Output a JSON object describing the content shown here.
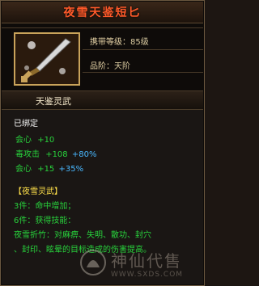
{
  "item": {
    "name": "夜雪天鉴短匕",
    "level_label": "携带等级：",
    "level_value": "85级",
    "grade_label": "品阶：",
    "grade_value": "天阶"
  },
  "section": {
    "title": "天鉴灵武"
  },
  "status": "已绑定",
  "stats": [
    {
      "name": "会心",
      "base": "+10"
    },
    {
      "name": "毒攻击",
      "base": "+108",
      "bonus": "+80%"
    },
    {
      "name": "会心",
      "base": "+15",
      "bonus": "+35%"
    }
  ],
  "set": {
    "title": "【夜雪灵武】",
    "bonus3": "3件：命中增加；",
    "bonus6": "6件：获得技能：",
    "skill_line1": "夜雪折竹：对麻痹、失明、散功、封穴",
    "skill_line2": "、封印、眩晕的目标造成的伤害提高。"
  },
  "watermark": {
    "text": "神仙代售",
    "url": "WWW.SXDS.COM"
  },
  "colors": {
    "title": "#ff5a2a",
    "stat_green": "#28d23c",
    "stat_blue": "#49b8ff",
    "set_yellow": "#ffe04a",
    "frame_gold": "#c9a35a"
  },
  "icons": {
    "item": "dagger-icon",
    "watermark": "logo-icon"
  }
}
